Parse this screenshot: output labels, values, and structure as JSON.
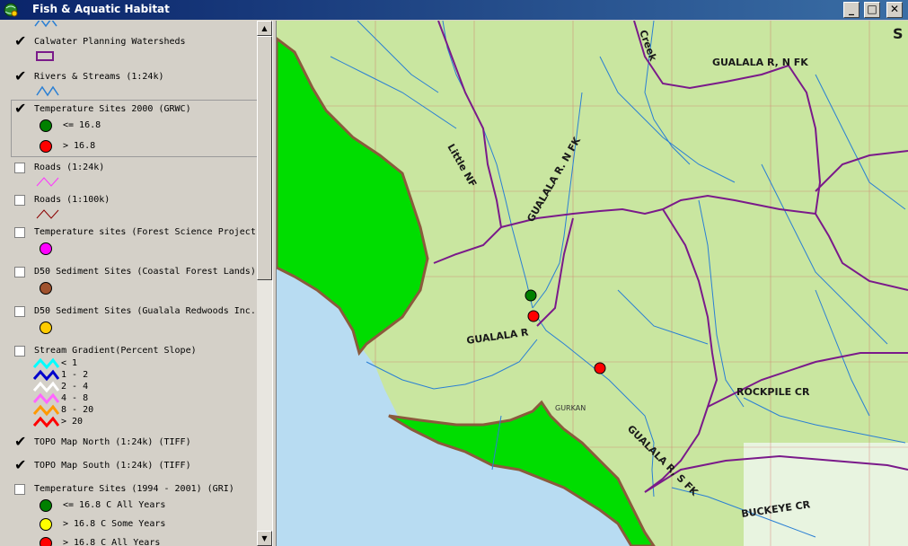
{
  "window": {
    "title": "Fish & Aquatic Habitat"
  },
  "window_controls": {
    "minimize": "_",
    "maximize": "□",
    "close": "✕"
  },
  "toc": {
    "layers": [
      {
        "name": "Calwater Planning Watersheds",
        "checked": true
      },
      {
        "name": "Rivers & Streams (1:24k)",
        "checked": true
      },
      {
        "name": "Temperature Sites 2000 (GRWC)",
        "checked": true,
        "symbols": [
          {
            "label": "<= 16.8",
            "color": "#008000"
          },
          {
            "label": "> 16.8",
            "color": "#ff0000"
          }
        ]
      },
      {
        "name": "Roads (1:24k)",
        "checked": false
      },
      {
        "name": "Roads (1:100k)",
        "checked": false
      },
      {
        "name": "Temperature sites (Forest Science Project)",
        "checked": false,
        "color": "#ff00ff"
      },
      {
        "name": "D50 Sediment Sites (Coastal Forest Lands)",
        "checked": false,
        "color": "#a0522d"
      },
      {
        "name": "D50 Sediment Sites (Gualala Redwoods Inc.)",
        "checked": false,
        "color": "#ffcc00"
      },
      {
        "name": "Stream Gradient(Percent Slope)",
        "checked": false,
        "classes": [
          {
            "label": "< 1",
            "color": "#00ffff"
          },
          {
            "label": "1 - 2",
            "color": "#0000cc"
          },
          {
            "label": "2 - 4",
            "color": "#ffffff"
          },
          {
            "label": "4 - 8",
            "color": "#ff66ff"
          },
          {
            "label": "8 - 20",
            "color": "#ff9900"
          },
          {
            "label": "> 20",
            "color": "#ff0000"
          }
        ]
      },
      {
        "name": "TOPO Map North (1:24k) (TIFF)",
        "checked": true
      },
      {
        "name": "TOPO Map South (1:24k) (TIFF)",
        "checked": true
      },
      {
        "name": "Temperature Sites (1994 - 2001) (GRI)",
        "checked": false,
        "symbols": [
          {
            "label": "<= 16.8 C All Years",
            "color": "#008000"
          },
          {
            "label": "> 16.8 C Some Years",
            "color": "#ffff00"
          },
          {
            "label": "> 16.8 C All Years",
            "color": "#ff0000"
          }
        ]
      }
    ]
  },
  "scrollbar": {
    "up_arrow": "▲",
    "down_arrow": "▼"
  },
  "map": {
    "labels": {
      "creek": "Creek",
      "little_nf": "Little NF",
      "nf_label": "GUALALA R, N FK",
      "nf_label_short": "GUALALA R. N FK",
      "gualala_r": "GUALALA R",
      "rockpile": "ROCKPILE CR",
      "sf_label": "GUALALA R, S FK",
      "buckeye": "BUCKEYE CR",
      "edge_label": "S",
      "gurkan": "GURKAN"
    },
    "colors": {
      "ocean": "#b8dcf2",
      "land": "#c9e6a0",
      "coast_green": "#00dd00",
      "watershed": "#7a1a8a",
      "stream": "#2a7fd4",
      "grid": "#c04040",
      "coast_outline": "#8b5a3c"
    }
  }
}
